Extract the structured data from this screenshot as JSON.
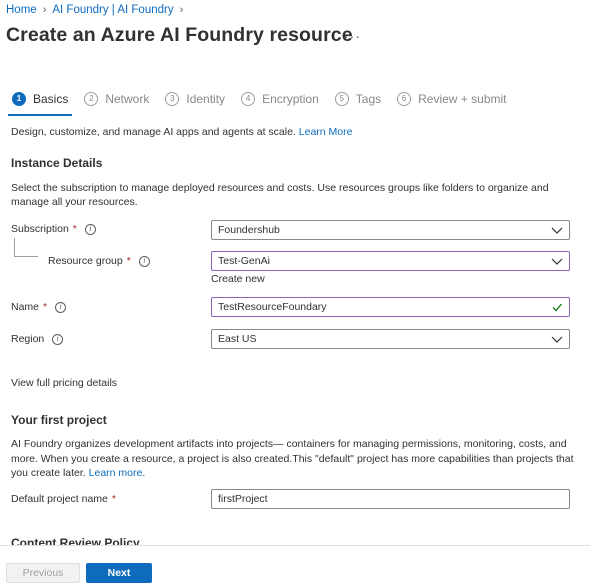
{
  "breadcrumb": {
    "home": "Home",
    "parent": "AI Foundry | AI Foundry"
  },
  "header": {
    "title": "Create an Azure AI Foundry resource",
    "more": "···"
  },
  "steps": [
    {
      "num": "1",
      "label": "Basics"
    },
    {
      "num": "2",
      "label": "Network"
    },
    {
      "num": "3",
      "label": "Identity"
    },
    {
      "num": "4",
      "label": "Encryption"
    },
    {
      "num": "5",
      "label": "Tags"
    },
    {
      "num": "6",
      "label": "Review + submit"
    }
  ],
  "intro": {
    "text": "Design, customize, and manage AI apps and agents at scale.",
    "learn_more": "Learn More"
  },
  "instance": {
    "title": "Instance Details",
    "desc_line1": "Select the subscription to manage deployed resources and costs. Use resources groups like folders to organize and",
    "desc_line2": "manage all your resources."
  },
  "form": {
    "subscription": {
      "label": "Subscription",
      "value": "Foundershub"
    },
    "resource_group": {
      "label": "Resource group",
      "value": "Test-GenAi",
      "create_new": "Create new"
    },
    "name": {
      "label": "Name",
      "value": "TestResourceFoundary"
    },
    "region": {
      "label": "Region",
      "value": "East US"
    },
    "required_mark": "*",
    "info_mark": "i"
  },
  "pricing_link": "View full pricing details",
  "project": {
    "title": "Your first project",
    "line1": "AI Foundry organizes development artifacts into projects— containers for managing permissions, monitoring, costs, and",
    "line2": "more. When you create a resource, a project is also created.This \"default\" project has more capabilities than projects that",
    "line3": "you create later.",
    "learn_more": "Learn more.",
    "default_name_label": "Default project name",
    "default_name_value": "firstProject"
  },
  "content_review": "Content Review Policy",
  "footer": {
    "previous": "Previous",
    "next": "Next"
  },
  "colors": {
    "accent": "#0f6cbd",
    "focus_border": "#8764b8",
    "required": "#a4262c",
    "valid_check": "#107c10"
  }
}
